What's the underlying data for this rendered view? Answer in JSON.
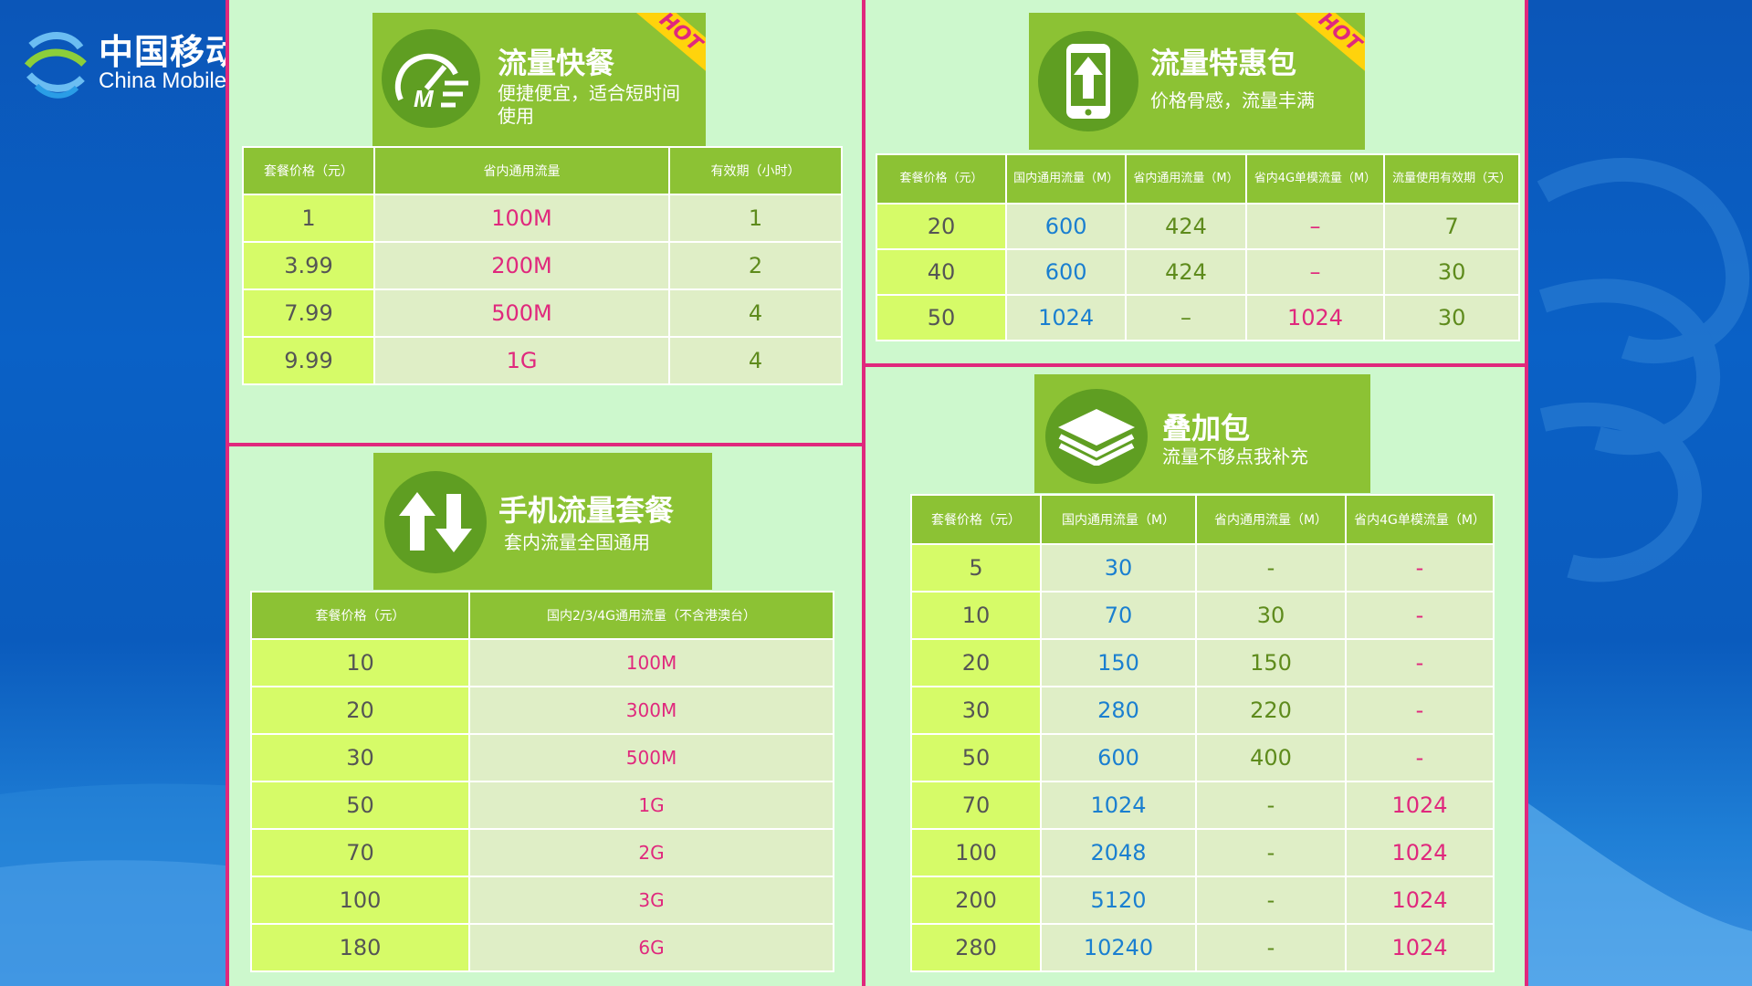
{
  "logo": {
    "cn": "中国移动",
    "en": "China Mobile"
  },
  "quick": {
    "title": "流量快餐",
    "subtitle": "便捷便宜，适合短时间使用",
    "badge": "HOT",
    "headers": [
      "套餐价格（元）",
      "省内通用流量",
      "有效期（小时）"
    ],
    "rows": [
      [
        "1",
        "100M",
        "1"
      ],
      [
        "3.99",
        "200M",
        "2"
      ],
      [
        "7.99",
        "500M",
        "4"
      ],
      [
        "9.99",
        "1G",
        "4"
      ]
    ]
  },
  "special": {
    "title": "流量特惠包",
    "subtitle": "价格骨感，流量丰满",
    "badge": "HOT",
    "headers": [
      "套餐价格（元）",
      "国内通用流量（M）",
      "省内通用流量（M）",
      "省内4G单模流量（M）",
      "流量使用有效期（天）"
    ],
    "rows": [
      [
        "20",
        "600",
        "424",
        "–",
        "7"
      ],
      [
        "40",
        "600",
        "424",
        "–",
        "30"
      ],
      [
        "50",
        "1024",
        "–",
        "1024",
        "30"
      ]
    ]
  },
  "mobile": {
    "title": "手机流量套餐",
    "subtitle": "套内流量全国通用",
    "headers": [
      "套餐价格（元）",
      "国内2/3/4G通用流量（不含港澳台）"
    ],
    "rows": [
      [
        "10",
        "100M"
      ],
      [
        "20",
        "300M"
      ],
      [
        "30",
        "500M"
      ],
      [
        "50",
        "1G"
      ],
      [
        "70",
        "2G"
      ],
      [
        "100",
        "3G"
      ],
      [
        "180",
        "6G"
      ]
    ]
  },
  "addon": {
    "title": "叠加包",
    "subtitle": "流量不够点我补充",
    "headers": [
      "套餐价格（元）",
      "国内通用流量（M）",
      "省内通用流量（M）",
      "省内4G单模流量（M）"
    ],
    "rows": [
      [
        "5",
        "30",
        "-",
        "-"
      ],
      [
        "10",
        "70",
        "30",
        "-"
      ],
      [
        "20",
        "150",
        "150",
        "-"
      ],
      [
        "30",
        "280",
        "220",
        "-"
      ],
      [
        "50",
        "600",
        "400",
        "-"
      ],
      [
        "70",
        "1024",
        "-",
        "1024"
      ],
      [
        "100",
        "2048",
        "-",
        "1024"
      ],
      [
        "200",
        "5120",
        "-",
        "1024"
      ],
      [
        "280",
        "10240",
        "-",
        "1024"
      ]
    ]
  }
}
